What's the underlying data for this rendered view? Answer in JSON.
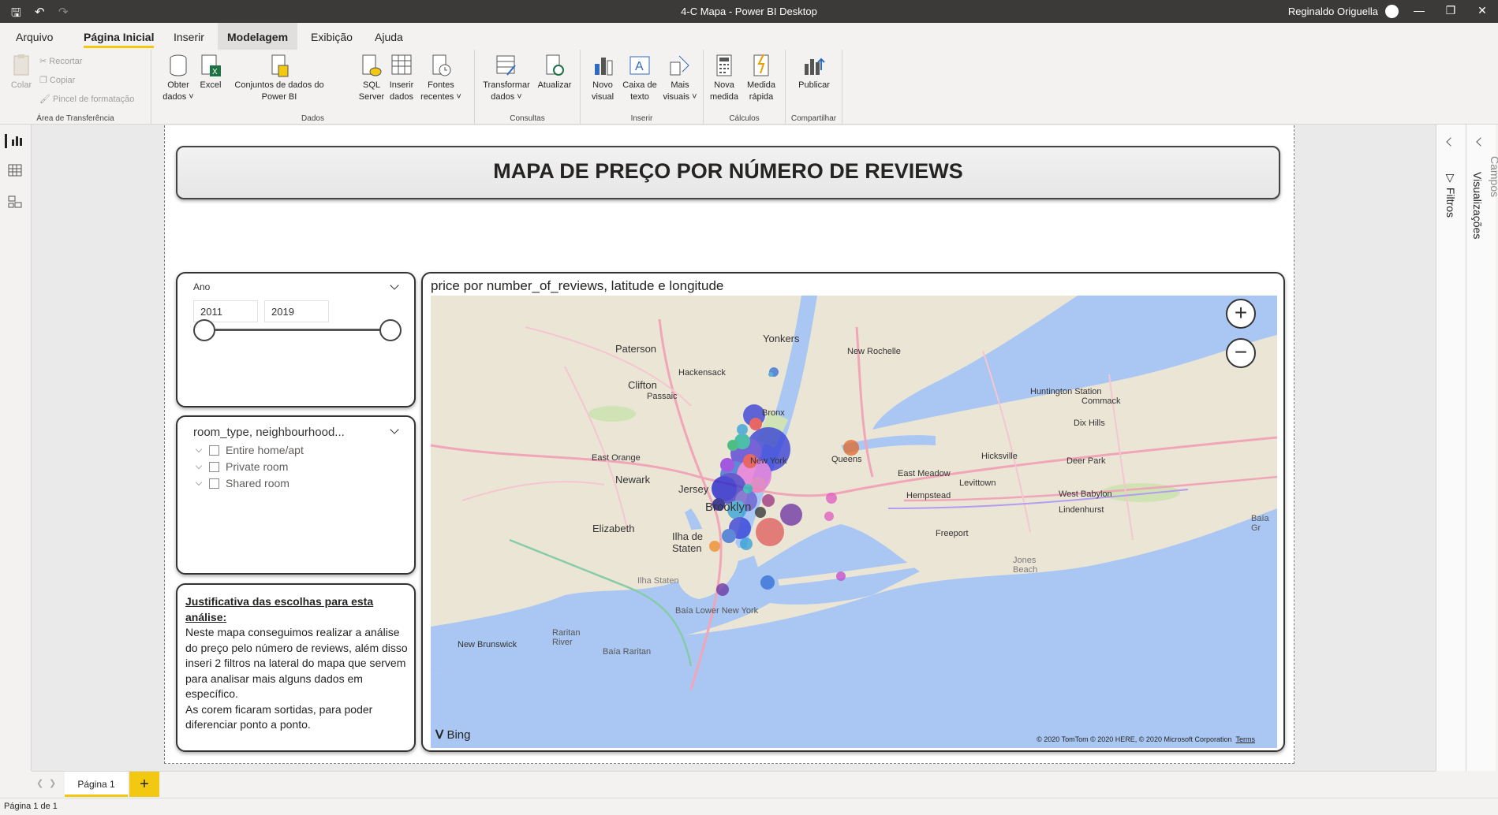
{
  "window": {
    "title": "4-C Mapa - Power BI Desktop",
    "user": "Reginaldo Origuella"
  },
  "menu": {
    "items": [
      "Arquivo",
      "Página Inicial",
      "Inserir",
      "Modelagem",
      "Exibição",
      "Ajuda"
    ]
  },
  "ribbon": {
    "clipboard": {
      "paste": "Colar",
      "cut": "Recortar",
      "copy": "Copiar",
      "format_painter": "Pincel de formatação",
      "group": "Área de Transferência"
    },
    "data": {
      "get_data": "Obter dados",
      "excel": "Excel",
      "datasets": "Conjuntos de dados do Power BI",
      "sql": "SQL Server",
      "enter_data": "Inserir dados",
      "recent": "Fontes recentes",
      "group": "Dados"
    },
    "queries": {
      "transform": "Transformar dados",
      "refresh": "Atualizar",
      "group": "Consultas"
    },
    "insert": {
      "new_visual": "Novo visual",
      "text_box": "Caixa de texto",
      "more_visuals": "Mais visuais",
      "group": "Inserir"
    },
    "calculations": {
      "new_measure": "Nova medida",
      "quick_measure": "Medida rápida",
      "group": "Cálculos"
    },
    "share": {
      "publish": "Publicar",
      "group": "Compartilhar"
    }
  },
  "report": {
    "title": "MAPA DE PREÇO POR NÚMERO DE REVIEWS",
    "year_slicer": {
      "label": "Ano",
      "from": "2011",
      "to": "2019"
    },
    "room_slicer": {
      "label": "room_type, neighbourhood...",
      "items": [
        "Entire home/apt",
        "Private room",
        "Shared room"
      ]
    },
    "justification": {
      "heading": "Justificativa das escolhas para esta análise:",
      "text": "Neste mapa conseguimos realizar a análise do preço pelo número de reviews, além disso inseri 2 filtros na lateral do mapa que servem para analisar mais alguns dados em específico.",
      "text2": "As corem ficaram sortidas, para poder diferenciar ponto a ponto."
    },
    "map": {
      "title": "price por number_of_reviews, latitude e longitude",
      "bing": "Bing",
      "copyright": "© 2020 TomTom © 2020 HERE, © 2020 Microsoft Corporation",
      "terms": "Terms",
      "places": [
        "Paterson",
        "Yonkers",
        "New Rochelle",
        "Hackensack",
        "Clifton",
        "Passaic",
        "Bronx",
        "Huntington Station",
        "Commack",
        "Dix Hills",
        "East Orange",
        "Queens",
        "Hicksville",
        "Deer Park",
        "Newark",
        "New York",
        "East Meadow",
        "Levittown",
        "Jersey",
        "Hempstead",
        "West Babylon",
        "Lindenhurst",
        "Brooklyn",
        "Elizabeth",
        "Freeport",
        "Ilha de Staten",
        "Ilha Staten",
        "Jones Beach",
        "Baía Lower New York",
        "New Brunswick",
        "Baía Raritan",
        "Raritan River",
        "Baía Gr"
      ]
    }
  },
  "panes": {
    "filters": "Filtros",
    "visualizations": "Visualizações",
    "fields": "Campos"
  },
  "pages": {
    "tab": "Página 1",
    "add": "+"
  },
  "status": "Página 1 de 1"
}
